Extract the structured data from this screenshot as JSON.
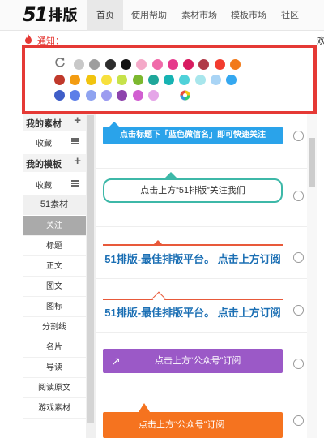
{
  "logo": {
    "number": "51",
    "text": "排版"
  },
  "nav": {
    "items": [
      {
        "label": "首页",
        "active": true
      },
      {
        "label": "使用帮助",
        "active": false
      },
      {
        "label": "素材市场",
        "active": false
      },
      {
        "label": "模板市场",
        "active": false
      },
      {
        "label": "社区",
        "active": false
      }
    ]
  },
  "notice": {
    "label": "通知：",
    "right_text": "欢"
  },
  "palette": {
    "colors": [
      "#c8c8c8",
      "#9e9e9e",
      "#2d2d2d",
      "#111111",
      "#f4a9c8",
      "#f06aa9",
      "#e6398c",
      "#d81b60",
      "#b03a48",
      "#f23c2f",
      "#f27a1a",
      "#c0392b",
      "#f39c12",
      "#f1c40f",
      "#f7e03d",
      "#c6e24a",
      "#7cb82f",
      "#1fa79a",
      "#17b3b3",
      "#4fd1d9",
      "#a8e6ec",
      "#a9d4f5",
      "#35a8f0",
      "#3f5ec8",
      "#5c7ee8",
      "#8fa3f0",
      "#9c9cf0",
      "#8e44ad",
      "#d15fd1",
      "#e5a6e8"
    ]
  },
  "sidebar": {
    "my_materials": "我的素材",
    "collect": "收藏",
    "my_templates": "我的模板",
    "collect2": "收藏",
    "categories": [
      "51素材",
      "关注",
      "标题",
      "正文",
      "图文",
      "图标",
      "分割线",
      "名片",
      "导读",
      "阅读原文",
      "游戏素材"
    ]
  },
  "templates": {
    "t1": "点击标题下「蓝色微信名」即可快速关注",
    "t2": "点击上方“51排版”关注我们",
    "t3": "51排版-最佳排版平台。 点击上方订阅",
    "t4": "51排版-最佳排版平台。 点击上方订阅",
    "t5": "点击上方“公众号”订阅",
    "t6": "点击上方“公众号”订阅"
  },
  "colors": {
    "highlight": "#e53935",
    "accent_blue": "#2aa3ea"
  }
}
